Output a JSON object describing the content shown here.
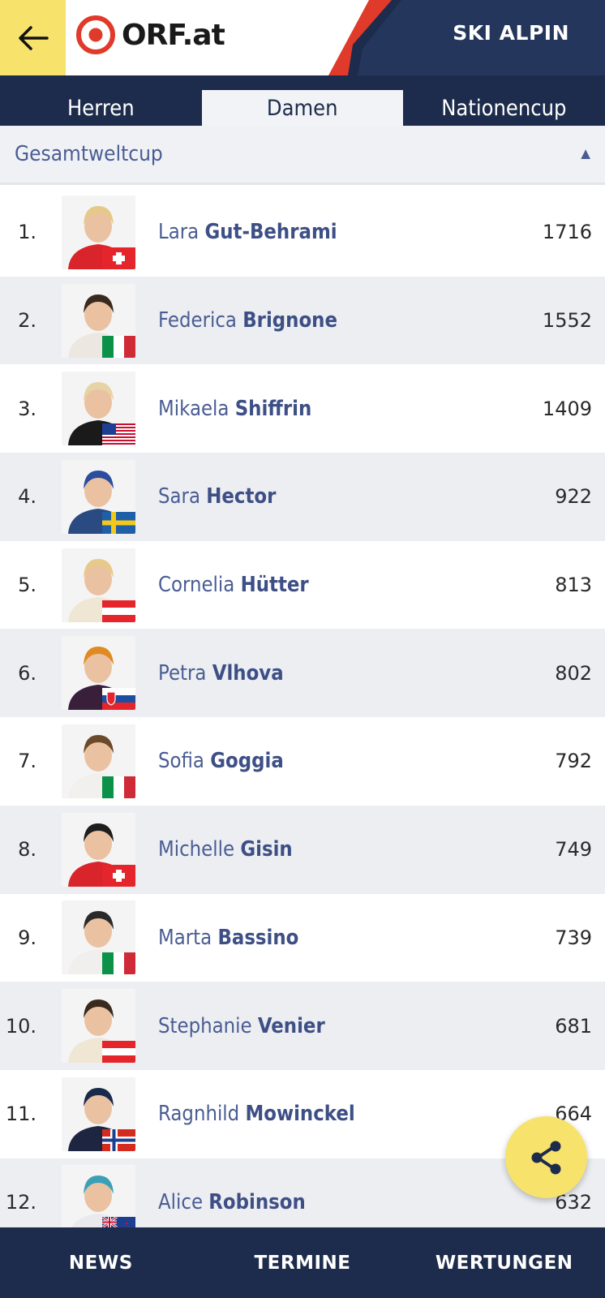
{
  "header": {
    "logo_text": "ORF.at",
    "section_title": "SKI ALPIN",
    "colors": {
      "accent_yellow": "#f7e26b",
      "navy": "#1d2c4c",
      "red": "#e03a2b"
    }
  },
  "tabs": [
    {
      "label": "Herren"
    },
    {
      "label": "Damen",
      "active": true
    },
    {
      "label": "Nationencup"
    }
  ],
  "filter": {
    "label": "Gesamtweltcup",
    "icon": "caret-up-icon"
  },
  "rows": [
    {
      "rank": "1.",
      "first": "Lara",
      "last": "Gut-Behrami",
      "points": "1716",
      "flag": "SUI"
    },
    {
      "rank": "2.",
      "first": "Federica",
      "last": "Brignone",
      "points": "1552",
      "flag": "ITA"
    },
    {
      "rank": "3.",
      "first": "Mikaela",
      "last": "Shiffrin",
      "points": "1409",
      "flag": "USA"
    },
    {
      "rank": "4.",
      "first": "Sara",
      "last": "Hector",
      "points": "922",
      "flag": "SWE"
    },
    {
      "rank": "5.",
      "first": "Cornelia",
      "last": "Hütter",
      "points": "813",
      "flag": "AUT"
    },
    {
      "rank": "6.",
      "first": "Petra",
      "last": "Vlhova",
      "points": "802",
      "flag": "SVK"
    },
    {
      "rank": "7.",
      "first": "Sofia",
      "last": "Goggia",
      "points": "792",
      "flag": "ITA"
    },
    {
      "rank": "8.",
      "first": "Michelle",
      "last": "Gisin",
      "points": "749",
      "flag": "SUI"
    },
    {
      "rank": "9.",
      "first": "Marta",
      "last": "Bassino",
      "points": "739",
      "flag": "ITA"
    },
    {
      "rank": "10.",
      "first": "Stephanie",
      "last": "Venier",
      "points": "681",
      "flag": "AUT"
    },
    {
      "rank": "11.",
      "first": "Ragnhild",
      "last": "Mowinckel",
      "points": "664",
      "flag": "NOR"
    },
    {
      "rank": "12.",
      "first": "Alice",
      "last": "Robinson",
      "points": "632",
      "flag": "NZL"
    }
  ],
  "share_button": {
    "icon": "share-icon"
  },
  "bottom_nav": [
    {
      "label": "NEWS"
    },
    {
      "label": "TERMINE"
    },
    {
      "label": "WERTUNGEN"
    }
  ]
}
